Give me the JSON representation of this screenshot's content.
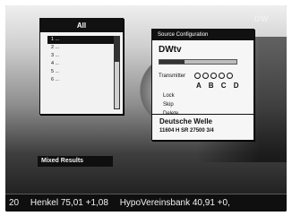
{
  "logo": "DW",
  "list_panel": {
    "title": "All",
    "items": [
      "1 ...",
      "2 ...",
      "3 ...",
      "4 ...",
      "5 ...",
      "6 ..."
    ],
    "selected_index": 0,
    "caption": "Mixed Results"
  },
  "config_panel": {
    "title": "Source Configuration",
    "channel_name": "DWtv",
    "signal_level": 0.32,
    "transmitter_label": "Transmitter",
    "letters": "A B C D",
    "menu": [
      "Lock",
      "Skip",
      "Delete"
    ],
    "footer_name": "Deutsche Welle",
    "footer_info": "11604 H  SR 27500  3/4"
  },
  "ticker": [
    "20",
    "Henkel 75,01 +1,08",
    "HypoVereinsbank 40,91 +0,"
  ]
}
